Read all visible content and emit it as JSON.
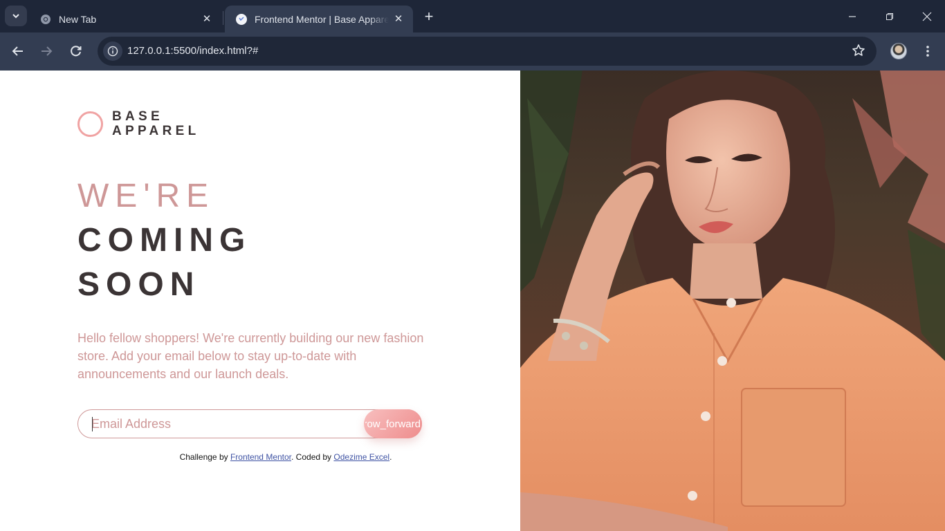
{
  "browser": {
    "tabs": [
      {
        "title": "New Tab",
        "active": false
      },
      {
        "title": "Frontend Mentor | Base Apparel coming soon page",
        "active": true
      }
    ],
    "url": "127.0.0.1:5500/index.html?#",
    "accent": "#333d52"
  },
  "page": {
    "logo": {
      "line1": "BASE",
      "line2": "APPAREL"
    },
    "headline": {
      "light": "WE'RE",
      "dark1": "COMING",
      "dark2": "SOON"
    },
    "intro": "Hello fellow shoppers! We're currently building our new fashion store. Add your email below to stay up-to-date with announcements and our launch deals.",
    "form": {
      "placeholder": "Email Address",
      "value": "",
      "submit_label": "arrow_forward"
    },
    "attribution": {
      "prefix": "Challenge by ",
      "link1": "Frontend Mentor",
      "middle": ". Coded by ",
      "link2": "Odezime Excel",
      "suffix": "."
    },
    "colors": {
      "desaturated_red": "#ce9797",
      "dark_grayish_red": "#3b3435",
      "pink_ring": "#f0a3a3"
    }
  }
}
